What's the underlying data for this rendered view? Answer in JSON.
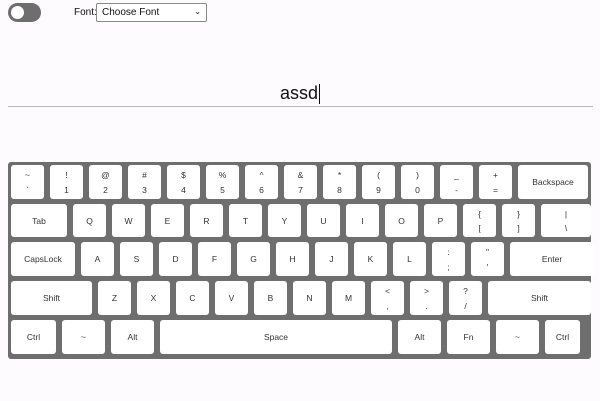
{
  "header": {
    "font_label": "Font:",
    "font_select_value": "Choose Font",
    "toggle_on": false
  },
  "typed_text": "assd",
  "keyboard": {
    "rows": [
      [
        {
          "top": "~",
          "bot": "`"
        },
        {
          "top": "!",
          "bot": "1"
        },
        {
          "top": "@",
          "bot": "2"
        },
        {
          "top": "#",
          "bot": "3"
        },
        {
          "top": "$",
          "bot": "4"
        },
        {
          "top": "%",
          "bot": "5"
        },
        {
          "top": "^",
          "bot": "6"
        },
        {
          "top": "&",
          "bot": "7"
        },
        {
          "top": "*",
          "bot": "8"
        },
        {
          "top": "(",
          "bot": "9"
        },
        {
          "top": ")",
          "bot": "0"
        },
        {
          "top": "_",
          "bot": "-"
        },
        {
          "top": "+",
          "bot": "="
        },
        {
          "label": "Backspace"
        }
      ],
      [
        {
          "label": "Tab"
        },
        {
          "label": "Q"
        },
        {
          "label": "W"
        },
        {
          "label": "E"
        },
        {
          "label": "R"
        },
        {
          "label": "T"
        },
        {
          "label": "Y"
        },
        {
          "label": "U"
        },
        {
          "label": "I"
        },
        {
          "label": "O"
        },
        {
          "label": "P"
        },
        {
          "top": "{",
          "bot": "["
        },
        {
          "top": "}",
          "bot": "]"
        },
        {
          "top": "|",
          "bot": "\\"
        }
      ],
      [
        {
          "label": "CapsLock"
        },
        {
          "label": "A"
        },
        {
          "label": "S"
        },
        {
          "label": "D"
        },
        {
          "label": "F"
        },
        {
          "label": "G"
        },
        {
          "label": "H"
        },
        {
          "label": "J"
        },
        {
          "label": "K"
        },
        {
          "label": "L"
        },
        {
          "top": ":",
          "bot": ";"
        },
        {
          "top": "\"",
          "bot": "'"
        },
        {
          "label": "Enter"
        }
      ],
      [
        {
          "label": "Shift"
        },
        {
          "label": "Z"
        },
        {
          "label": "X"
        },
        {
          "label": "C"
        },
        {
          "label": "V"
        },
        {
          "label": "B"
        },
        {
          "label": "N"
        },
        {
          "label": "M"
        },
        {
          "top": "<",
          "bot": ","
        },
        {
          "top": ">",
          "bot": "."
        },
        {
          "top": "?",
          "bot": "/"
        },
        {
          "label": "Shift"
        }
      ],
      [
        {
          "label": "Ctrl"
        },
        {
          "label": "~"
        },
        {
          "label": "Alt"
        },
        {
          "label": "Space"
        },
        {
          "label": "Alt"
        },
        {
          "label": "Fn"
        },
        {
          "label": "~"
        },
        {
          "label": "Ctrl"
        }
      ]
    ]
  }
}
